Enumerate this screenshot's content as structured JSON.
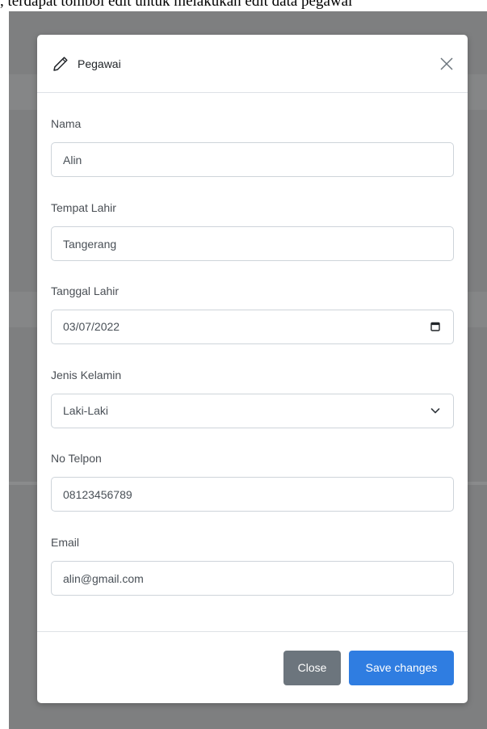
{
  "caption": ", terdapat tombol edit untuk melakukan edit data pegawai",
  "modal": {
    "title": "Pegawai",
    "header_icon": "pencil-icon",
    "close_icon": "close-icon"
  },
  "form": {
    "nama": {
      "label": "Nama",
      "value": "Alin"
    },
    "tempat_lahir": {
      "label": "Tempat Lahir",
      "value": "Tangerang"
    },
    "tanggal_lahir": {
      "label": "Tanggal Lahir",
      "value": "03/07/2022",
      "icon": "calendar-icon"
    },
    "jenis_kelamin": {
      "label": "Jenis Kelamin",
      "value": "Laki-Laki",
      "icon": "chevron-down-icon"
    },
    "no_telpon": {
      "label": "No Telpon",
      "value": "08123456789"
    },
    "email": {
      "label": "Email",
      "value": "alin@gmail.com"
    }
  },
  "footer": {
    "close_label": "Close",
    "save_label": "Save changes"
  },
  "colors": {
    "backdrop": "#7e7f80",
    "primary": "#2f7de1",
    "secondary": "#6c757d",
    "border": "#ced4da"
  }
}
